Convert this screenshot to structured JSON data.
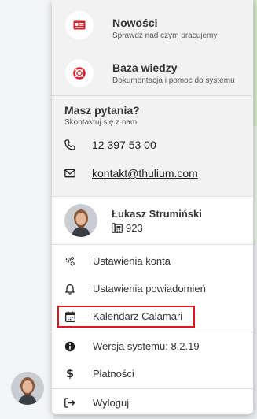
{
  "features": [
    {
      "title": "Nowości",
      "subtitle": "Sprawdź nad czym pracujemy",
      "icon": "news-card-icon"
    },
    {
      "title": "Baza wiedzy",
      "subtitle": "Dokumentacja i pomoc do systemu",
      "icon": "lifebuoy-icon"
    }
  ],
  "contact": {
    "heading": "Masz pytania?",
    "subheading": "Skontaktuj się z nami",
    "phone": "12 397 53 00",
    "email": "kontakt@thulium.com"
  },
  "user": {
    "name": "Łukasz Strumiński",
    "extension": "923"
  },
  "menu": {
    "account_settings": "Ustawienia konta",
    "notification_settings": "Ustawienia powiadomień",
    "calendar": "Kalendarz Calamari",
    "version": "Wersja systemu: 8.2.19",
    "payments": "Płatności",
    "logout": "Wyloguj"
  },
  "colors": {
    "accent_red": "#d6202a",
    "highlight_border": "#e0141c"
  }
}
